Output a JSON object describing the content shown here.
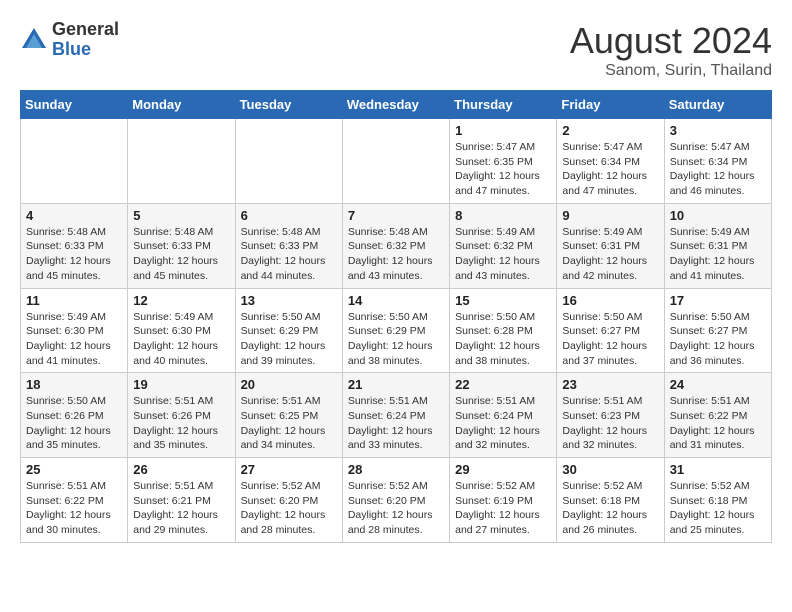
{
  "logo": {
    "general": "General",
    "blue": "Blue"
  },
  "title": "August 2024",
  "location": "Sanom, Surin, Thailand",
  "days_of_week": [
    "Sunday",
    "Monday",
    "Tuesday",
    "Wednesday",
    "Thursday",
    "Friday",
    "Saturday"
  ],
  "weeks": [
    [
      {
        "day": "",
        "info": ""
      },
      {
        "day": "",
        "info": ""
      },
      {
        "day": "",
        "info": ""
      },
      {
        "day": "",
        "info": ""
      },
      {
        "day": "1",
        "info": "Sunrise: 5:47 AM\nSunset: 6:35 PM\nDaylight: 12 hours\nand 47 minutes."
      },
      {
        "day": "2",
        "info": "Sunrise: 5:47 AM\nSunset: 6:34 PM\nDaylight: 12 hours\nand 47 minutes."
      },
      {
        "day": "3",
        "info": "Sunrise: 5:47 AM\nSunset: 6:34 PM\nDaylight: 12 hours\nand 46 minutes."
      }
    ],
    [
      {
        "day": "4",
        "info": "Sunrise: 5:48 AM\nSunset: 6:33 PM\nDaylight: 12 hours\nand 45 minutes."
      },
      {
        "day": "5",
        "info": "Sunrise: 5:48 AM\nSunset: 6:33 PM\nDaylight: 12 hours\nand 45 minutes."
      },
      {
        "day": "6",
        "info": "Sunrise: 5:48 AM\nSunset: 6:33 PM\nDaylight: 12 hours\nand 44 minutes."
      },
      {
        "day": "7",
        "info": "Sunrise: 5:48 AM\nSunset: 6:32 PM\nDaylight: 12 hours\nand 43 minutes."
      },
      {
        "day": "8",
        "info": "Sunrise: 5:49 AM\nSunset: 6:32 PM\nDaylight: 12 hours\nand 43 minutes."
      },
      {
        "day": "9",
        "info": "Sunrise: 5:49 AM\nSunset: 6:31 PM\nDaylight: 12 hours\nand 42 minutes."
      },
      {
        "day": "10",
        "info": "Sunrise: 5:49 AM\nSunset: 6:31 PM\nDaylight: 12 hours\nand 41 minutes."
      }
    ],
    [
      {
        "day": "11",
        "info": "Sunrise: 5:49 AM\nSunset: 6:30 PM\nDaylight: 12 hours\nand 41 minutes."
      },
      {
        "day": "12",
        "info": "Sunrise: 5:49 AM\nSunset: 6:30 PM\nDaylight: 12 hours\nand 40 minutes."
      },
      {
        "day": "13",
        "info": "Sunrise: 5:50 AM\nSunset: 6:29 PM\nDaylight: 12 hours\nand 39 minutes."
      },
      {
        "day": "14",
        "info": "Sunrise: 5:50 AM\nSunset: 6:29 PM\nDaylight: 12 hours\nand 38 minutes."
      },
      {
        "day": "15",
        "info": "Sunrise: 5:50 AM\nSunset: 6:28 PM\nDaylight: 12 hours\nand 38 minutes."
      },
      {
        "day": "16",
        "info": "Sunrise: 5:50 AM\nSunset: 6:27 PM\nDaylight: 12 hours\nand 37 minutes."
      },
      {
        "day": "17",
        "info": "Sunrise: 5:50 AM\nSunset: 6:27 PM\nDaylight: 12 hours\nand 36 minutes."
      }
    ],
    [
      {
        "day": "18",
        "info": "Sunrise: 5:50 AM\nSunset: 6:26 PM\nDaylight: 12 hours\nand 35 minutes."
      },
      {
        "day": "19",
        "info": "Sunrise: 5:51 AM\nSunset: 6:26 PM\nDaylight: 12 hours\nand 35 minutes."
      },
      {
        "day": "20",
        "info": "Sunrise: 5:51 AM\nSunset: 6:25 PM\nDaylight: 12 hours\nand 34 minutes."
      },
      {
        "day": "21",
        "info": "Sunrise: 5:51 AM\nSunset: 6:24 PM\nDaylight: 12 hours\nand 33 minutes."
      },
      {
        "day": "22",
        "info": "Sunrise: 5:51 AM\nSunset: 6:24 PM\nDaylight: 12 hours\nand 32 minutes."
      },
      {
        "day": "23",
        "info": "Sunrise: 5:51 AM\nSunset: 6:23 PM\nDaylight: 12 hours\nand 32 minutes."
      },
      {
        "day": "24",
        "info": "Sunrise: 5:51 AM\nSunset: 6:22 PM\nDaylight: 12 hours\nand 31 minutes."
      }
    ],
    [
      {
        "day": "25",
        "info": "Sunrise: 5:51 AM\nSunset: 6:22 PM\nDaylight: 12 hours\nand 30 minutes."
      },
      {
        "day": "26",
        "info": "Sunrise: 5:51 AM\nSunset: 6:21 PM\nDaylight: 12 hours\nand 29 minutes."
      },
      {
        "day": "27",
        "info": "Sunrise: 5:52 AM\nSunset: 6:20 PM\nDaylight: 12 hours\nand 28 minutes."
      },
      {
        "day": "28",
        "info": "Sunrise: 5:52 AM\nSunset: 6:20 PM\nDaylight: 12 hours\nand 28 minutes."
      },
      {
        "day": "29",
        "info": "Sunrise: 5:52 AM\nSunset: 6:19 PM\nDaylight: 12 hours\nand 27 minutes."
      },
      {
        "day": "30",
        "info": "Sunrise: 5:52 AM\nSunset: 6:18 PM\nDaylight: 12 hours\nand 26 minutes."
      },
      {
        "day": "31",
        "info": "Sunrise: 5:52 AM\nSunset: 6:18 PM\nDaylight: 12 hours\nand 25 minutes."
      }
    ]
  ]
}
